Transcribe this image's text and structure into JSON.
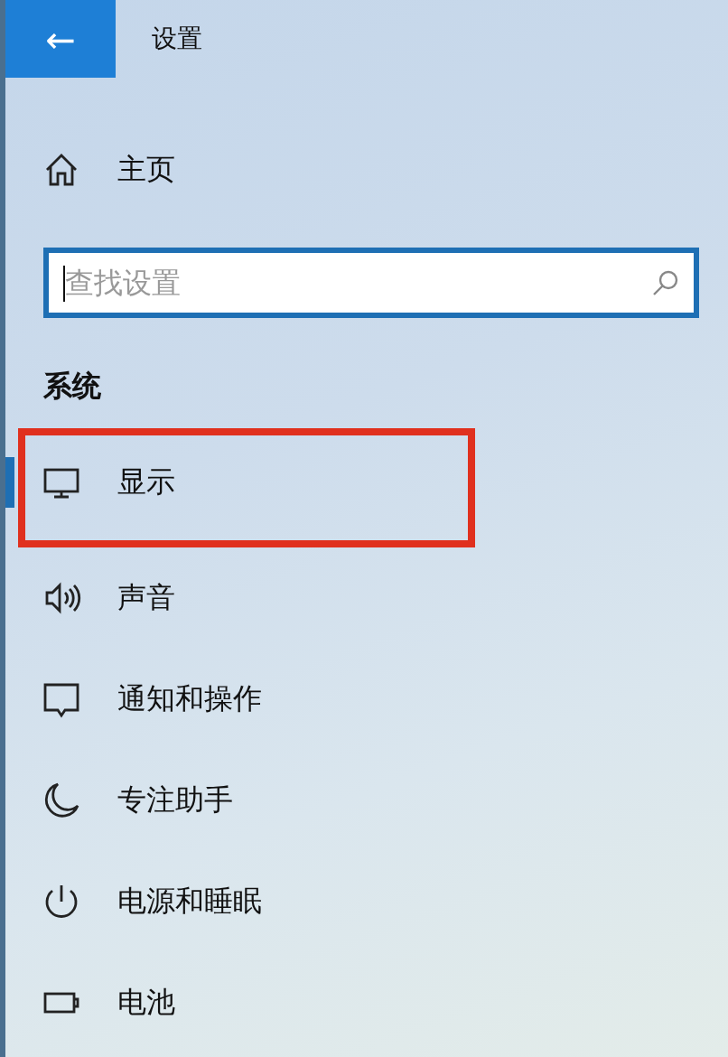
{
  "header": {
    "back_icon": "←",
    "title": "设置"
  },
  "home": {
    "label": "主页"
  },
  "search": {
    "placeholder": "查找设置",
    "focused": true
  },
  "section": {
    "title": "系统"
  },
  "items": [
    {
      "kind": "display",
      "label": "显示",
      "selected": true,
      "highlighted": true
    },
    {
      "kind": "sound",
      "label": "声音",
      "selected": false,
      "highlighted": false
    },
    {
      "kind": "notifications",
      "label": "通知和操作",
      "selected": false,
      "highlighted": false
    },
    {
      "kind": "focus",
      "label": "专注助手",
      "selected": false,
      "highlighted": false
    },
    {
      "kind": "power",
      "label": "电源和睡眠",
      "selected": false,
      "highlighted": false
    },
    {
      "kind": "battery",
      "label": "电池",
      "selected": false,
      "highlighted": false
    }
  ]
}
